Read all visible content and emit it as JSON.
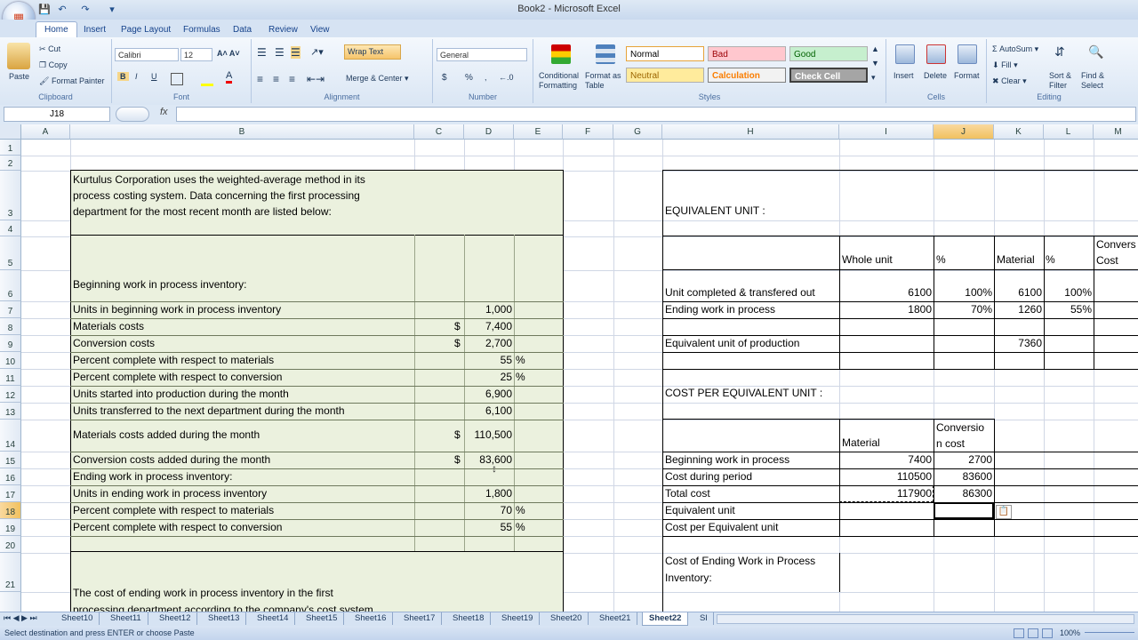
{
  "window": {
    "title": "Book2 - Microsoft Excel"
  },
  "ribbon": {
    "tabs": [
      "Home",
      "Insert",
      "Page Layout",
      "Formulas",
      "Data",
      "Review",
      "View"
    ],
    "clipboard": {
      "paste": "Paste",
      "cut": "Cut",
      "copy": "Copy",
      "format_painter": "Format Painter",
      "label": "Clipboard"
    },
    "font": {
      "name": "Calibri",
      "size": "12",
      "label": "Font"
    },
    "alignment": {
      "wrap": "Wrap Text",
      "merge": "Merge & Center",
      "label": "Alignment"
    },
    "number": {
      "format": "General",
      "label": "Number",
      "currency": "$",
      "percent": "%"
    },
    "styles": {
      "conditional": "Conditional Formatting",
      "format_table": "Format as Table",
      "normal": "Normal",
      "bad": "Bad",
      "good": "Good",
      "neutral": "Neutral",
      "calculation": "Calculation",
      "check_cell": "Check Cell",
      "label": "Styles"
    },
    "cells": {
      "insert": "Insert",
      "delete": "Delete",
      "format": "Format",
      "label": "Cells"
    },
    "editing": {
      "autosum": "AutoSum",
      "fill": "Fill",
      "clear": "Clear",
      "sort": "Sort & Filter",
      "find": "Find & Select",
      "label": "Editing"
    }
  },
  "formula_bar": {
    "name_box": "J18",
    "fx": "fx",
    "value": ""
  },
  "columns": [
    "A",
    "B",
    "C",
    "D",
    "E",
    "F",
    "G",
    "H",
    "I",
    "J",
    "K",
    "L",
    "M"
  ],
  "rows": [
    "1",
    "2",
    "3",
    "4",
    "5",
    "6",
    "7",
    "8",
    "9",
    "10",
    "11",
    "12",
    "13",
    "14",
    "15",
    "16",
    "17",
    "18",
    "19",
    "20",
    "21"
  ],
  "left_table": {
    "intro": [
      "Kurtulus Corporation uses the weighted-average method in its",
      "process costing system. Data concerning the first processing",
      "department for the most recent month are listed below:"
    ],
    "r6": "Beginning work in process inventory:",
    "r7": {
      "label": "Units in beginning work in process inventory",
      "value": "1,000"
    },
    "r8": {
      "label": "Materials costs",
      "cur": "$",
      "value": "7,400"
    },
    "r9": {
      "label": "Conversion costs",
      "cur": "$",
      "value": "2,700"
    },
    "r10": {
      "label": "Percent complete with respect to materials",
      "value": "55",
      "unit": "%"
    },
    "r11": {
      "label": "Percent complete with respect to conversion",
      "value": "25",
      "unit": "%"
    },
    "r12": {
      "label": "Units started into production during the month",
      "value": "6,900"
    },
    "r13": {
      "label": "Units transferred to the next department during the month",
      "value": "6,100"
    },
    "r14": {
      "label": "Materials costs added during the month",
      "cur": "$",
      "value": "110,500"
    },
    "r15": {
      "label": "Conversion costs added during the month",
      "cur": "$",
      "value": "83,600"
    },
    "r16": "Ending work in process inventory:",
    "r17": {
      "label": "Units in ending work in process inventory",
      "value": "1,800"
    },
    "r18": {
      "label": "Percent complete with respect to materials",
      "value": "70",
      "unit": "%"
    },
    "r19": {
      "label": "Percent complete with respect to conversion",
      "value": "55",
      "unit": "%"
    },
    "r21": [
      "The cost of ending work in process inventory in the first",
      "processing department according to the company's cost system"
    ]
  },
  "right_table": {
    "eq_title": "EQUIVALENT UNIT :",
    "hdr_whole": "Whole unit",
    "hdr_pct1": "%",
    "hdr_material": "Material",
    "hdr_pct2": "%",
    "hdr_conv": [
      "Convers",
      "Cost"
    ],
    "r6": {
      "label": "Unit completed & transfered out",
      "whole": "6100",
      "pct": "100%",
      "mat": "6100",
      "pct2": "100%"
    },
    "r7": {
      "label": "Ending work in process",
      "whole": "1800",
      "pct": "70%",
      "mat": "1260",
      "pct2": "55%"
    },
    "r9": {
      "label": "Equivalent unit of production",
      "mat": "7360"
    },
    "cpe_title": "COST PER EQUIVALENT UNIT :",
    "hdr2_material": "Material",
    "hdr2_conv": [
      "Conversio",
      "n cost"
    ],
    "r15": {
      "label": "Beginning work in process",
      "mat": "7400",
      "conv": "2700"
    },
    "r16": {
      "label": "Cost during period",
      "mat": "110500",
      "conv": "83600"
    },
    "r17": {
      "label": "Total cost",
      "mat": "117900",
      "conv": "86300"
    },
    "r18": {
      "label": "Equivalent unit"
    },
    "r19": {
      "label": "Cost per Equivalent unit"
    },
    "r21": [
      "Cost of Ending Work in Process",
      "Inventory:"
    ]
  },
  "sheets": [
    "Sheet10",
    "Sheet11",
    "Sheet12",
    "Sheet13",
    "Sheet14",
    "Sheet15",
    "Sheet16",
    "Sheet17",
    "Sheet18",
    "Sheet19",
    "Sheet20",
    "Sheet21",
    "Sheet22",
    "Sl"
  ],
  "active_sheet": "Sheet22",
  "status": {
    "message": "Select destination and press ENTER or choose Paste",
    "zoom": "100%"
  }
}
